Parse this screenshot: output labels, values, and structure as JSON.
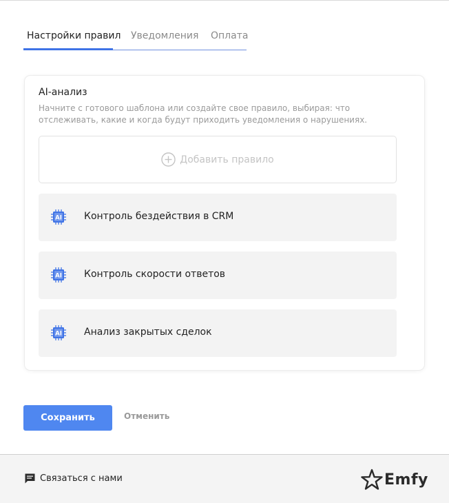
{
  "tabs": [
    {
      "label": "Настройки правил",
      "active": true
    },
    {
      "label": "Уведомления",
      "active": false
    },
    {
      "label": "Оплата",
      "active": false
    }
  ],
  "card": {
    "title": "AI-анализ",
    "description": "Начните с готового шаблона или создайте свое правило, выбирая: что отслеживать, какие и когда будут приходить уведомления о нарушениях.",
    "add_rule_label": "Добавить правило",
    "rules": [
      {
        "label": "Контроль бездействия в CRM",
        "icon": "ai-chip-icon"
      },
      {
        "label": "Контроль скорости ответов",
        "icon": "ai-chip-icon"
      },
      {
        "label": "Анализ закрытых сделок",
        "icon": "ai-chip-icon"
      }
    ]
  },
  "actions": {
    "save_label": "Сохранить",
    "cancel_label": "Отменить"
  },
  "footer": {
    "contact_label": "Связаться с нами",
    "brand": "Emfy"
  },
  "colors": {
    "accent": "#3f73e6",
    "button": "#4f87f0",
    "rule_bg": "#f3f3f3",
    "muted_text": "#9a9a9a"
  }
}
